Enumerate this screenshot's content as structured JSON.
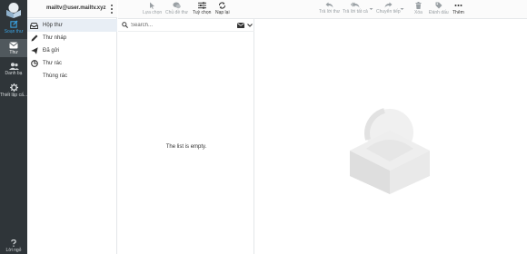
{
  "nav": {
    "items": [
      {
        "label": "Soạn thư",
        "icon": "compose-icon"
      },
      {
        "label": "Thư",
        "icon": "mail-icon"
      },
      {
        "label": "Danh bạ",
        "icon": "contacts-icon"
      },
      {
        "label": "Thiết lập cấ...",
        "icon": "gear-icon"
      },
      {
        "label": "Lời ngỏ",
        "icon": "help-icon"
      }
    ]
  },
  "account": {
    "email": "mailtv@user.mailtv.xyz"
  },
  "folders": [
    {
      "label": "Hộp thư",
      "icon": "inbox-icon"
    },
    {
      "label": "Thư nháp",
      "icon": "pencil-icon"
    },
    {
      "label": "Đã gửi",
      "icon": "send-icon"
    },
    {
      "label": "Thư rác",
      "icon": "spam-icon"
    },
    {
      "label": "Thùng rác",
      "icon": "trash-icon"
    }
  ],
  "search": {
    "placeholder": "Search..."
  },
  "message_list": {
    "empty_text": "The list is empty."
  },
  "toolbar": {
    "select": "Lựa chọn",
    "threads": "Chủ đề thư",
    "options": "Tuỳ chọn",
    "refresh": "Nạp lại",
    "reply": "Trả lời thư",
    "reply_all": "Trả lời tất cả",
    "forward": "Chuyển tiếp",
    "delete": "Xóa",
    "mark": "Đánh dấu",
    "more": "Thêm"
  },
  "colors": {
    "rail": "#2f3539",
    "rail_active": "#50585d",
    "accent": "#3aa3e3",
    "active_folder": "#e8eef5"
  }
}
